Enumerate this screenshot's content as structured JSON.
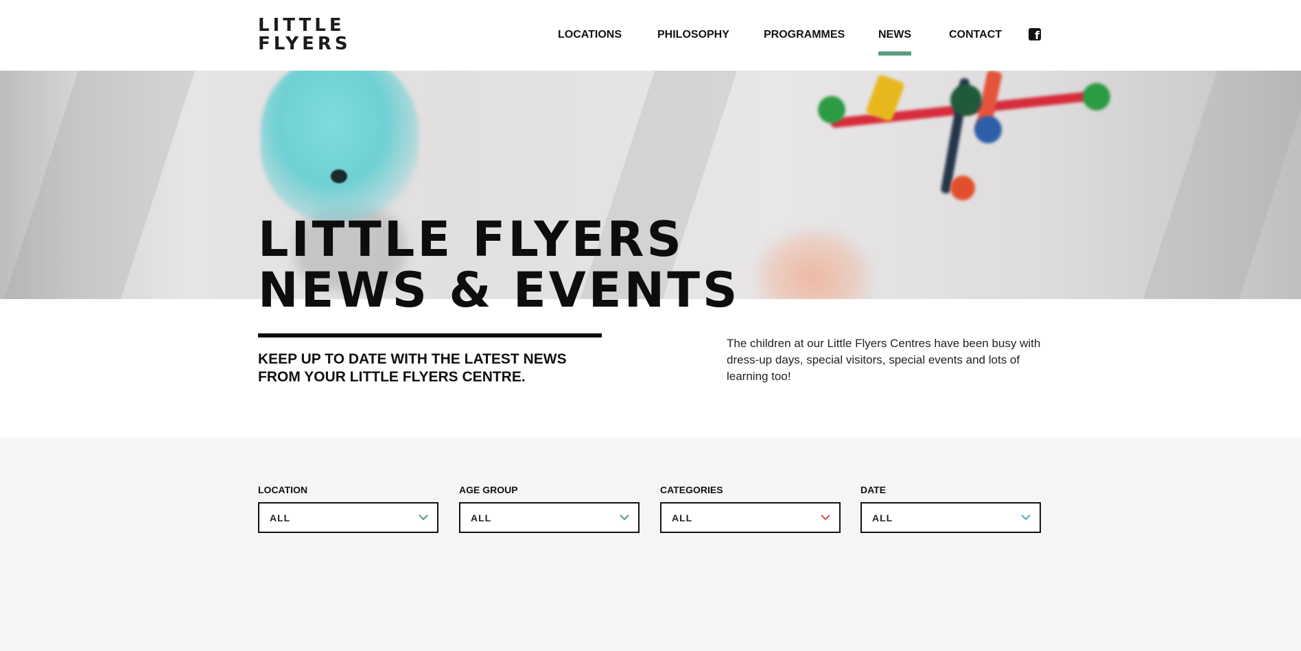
{
  "brand": {
    "logo_line1": "LITTLE",
    "logo_line2": "FLYERS"
  },
  "nav": {
    "items": [
      {
        "label": "LOCATIONS"
      },
      {
        "label": "PHILOSOPHY"
      },
      {
        "label": "PROGRAMMES"
      },
      {
        "label": "NEWS",
        "active": true
      },
      {
        "label": "CONTACT"
      }
    ],
    "social_icon": "facebook-icon",
    "active_color": "#5a9e82"
  },
  "hero": {
    "title_line1": "LITTLE FLYERS",
    "title_line2": "NEWS & EVENTS",
    "subtitle": "KEEP UP TO DATE WITH THE LATEST NEWS FROM YOUR LITTLE FLYERS CENTRE.",
    "intro": "The children at our Little Flyers Centres have been busy with dress-up days, special visitors, special events and lots of learning too!"
  },
  "filters": [
    {
      "label": "LOCATION",
      "value": "ALL",
      "chevron_color": "#5a9e82"
    },
    {
      "label": "AGE GROUP",
      "value": "ALL",
      "chevron_color": "#5a9e82"
    },
    {
      "label": "CATEGORIES",
      "value": "ALL",
      "chevron_color": "#d9545f"
    },
    {
      "label": "DATE",
      "value": "ALL",
      "chevron_color": "#5aa8c9"
    }
  ]
}
